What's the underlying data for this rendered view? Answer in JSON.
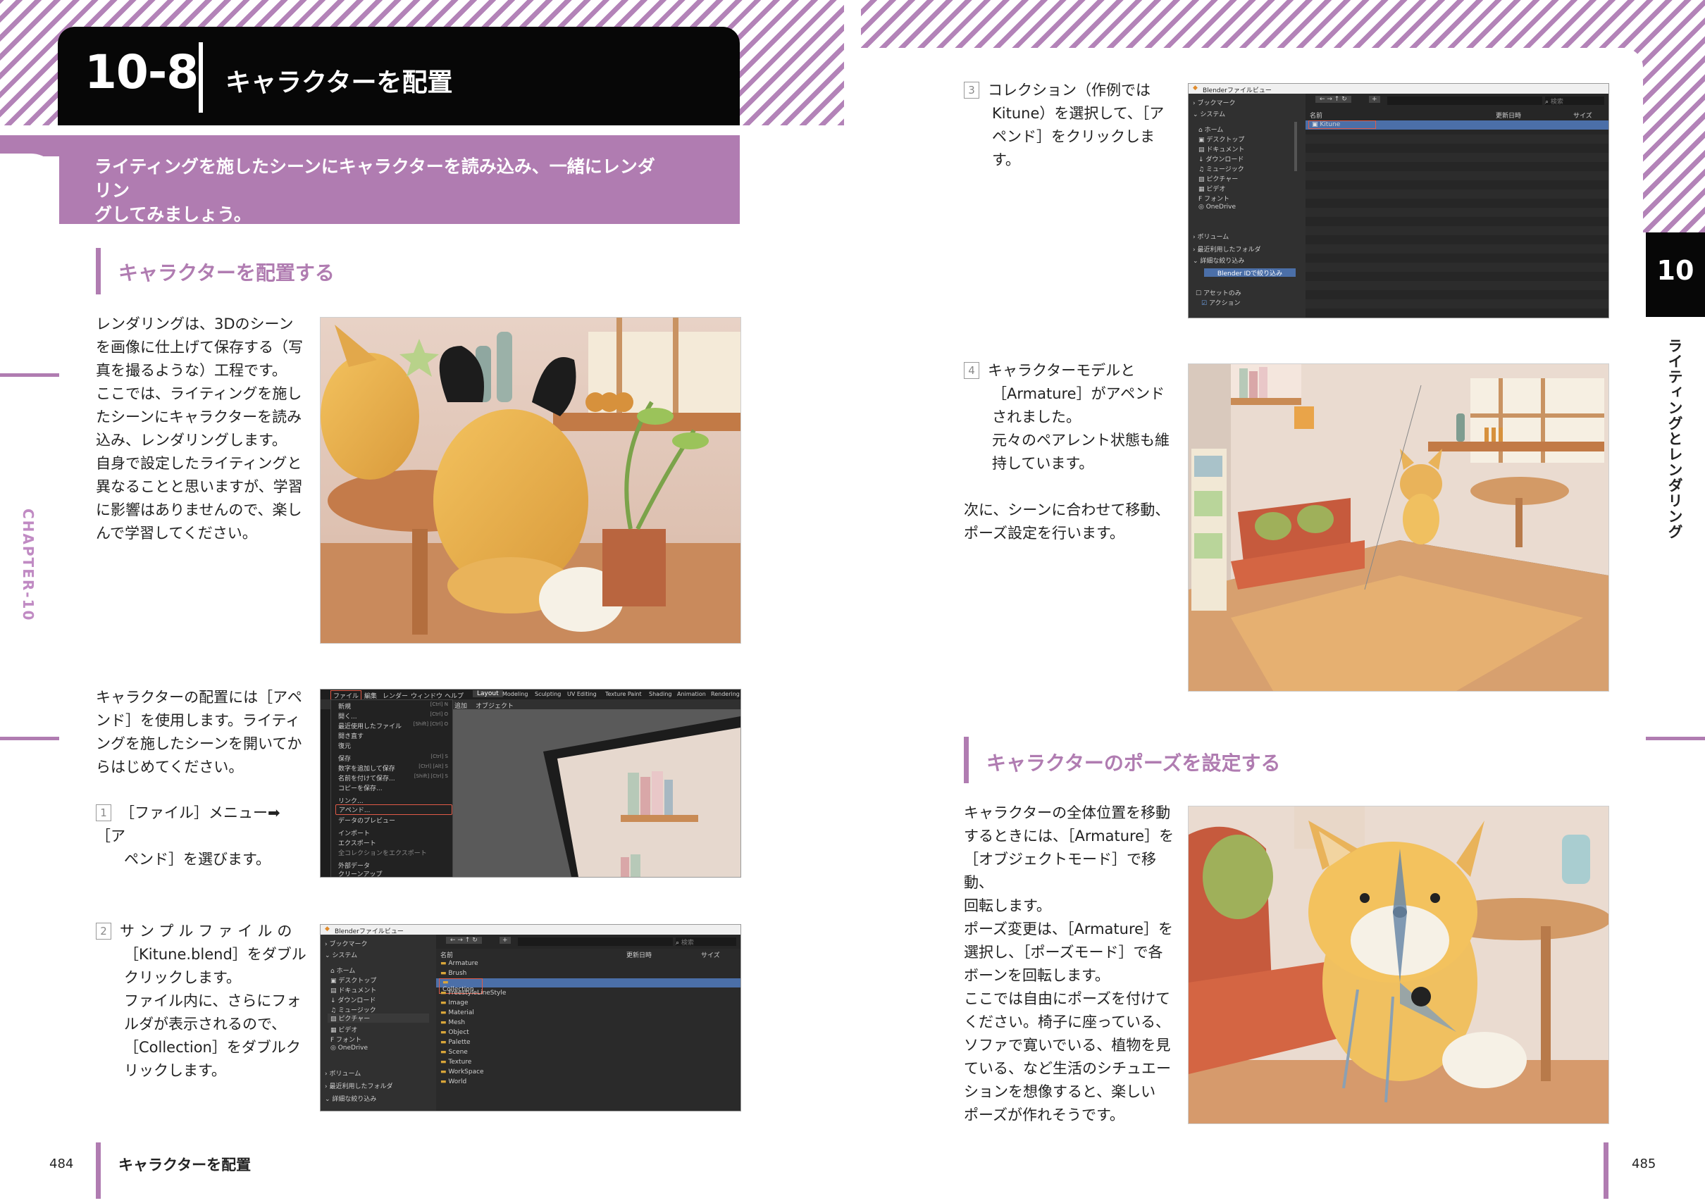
{
  "section": {
    "number": "10-8",
    "title": "キャラクターを配置"
  },
  "lead": [
    "ライティングを施したシーンにキャラクターを読み込み、一緒にレンダリン",
    "グしてみましょう。"
  ],
  "left": {
    "heading": "キャラクターを配置する",
    "intro": [
      "レンダリングは、3Dのシーン",
      "を画像に仕上げて保存する（写",
      "真を撮るような）工程です。",
      "ここでは、ライティングを施し",
      "たシーンにキャラクターを読み",
      "込み、レンダリングします。",
      "自身で設定したライティングと",
      "異なることと思いますが、学習",
      "に影響はありませんので、楽し",
      "んで学習してください。"
    ],
    "append_intro": [
      "キャラクターの配置には［アペ",
      "ンド］を使用します。ライティ",
      "ングを施したシーンを開いてか",
      "らはじめてください。"
    ],
    "step1": {
      "num": "1",
      "lines": [
        "［ファイル］メニュー➡［ア",
        "ペンド］を選びます。"
      ]
    },
    "step2": {
      "num": "2",
      "lines": [
        "サンプルファイルの",
        "［Kitune.blend］をダブル",
        "クリックします。",
        "ファイル内に、さらにフォ",
        "ルダが表示されるので、",
        "［Collection］をダブルク",
        "リックします。"
      ]
    }
  },
  "right": {
    "step3": {
      "num": "3",
      "lines": [
        "コレクション（作例では",
        "Kitune）を選択して、［ア",
        "ペンド］をクリックします。"
      ]
    },
    "step4": {
      "num": "4",
      "lines": [
        "キャラクターモデルと",
        "［Armature］がアペンド",
        "されました。",
        "元々のペアレント状態も維",
        "持しています。"
      ]
    },
    "step4_next": [
      "次に、シーンに合わせて移動、",
      "ポーズ設定を行います。"
    ],
    "heading": "キャラクターのポーズを設定する",
    "pose": [
      "キャラクターの全体位置を移動",
      "するときには、［Armature］を",
      "［オブジェクトモード］で移動、",
      "回転します。",
      "ポーズ変更は、［Armature］を",
      "選択し、［ポーズモード］で各",
      "ボーンを回転します。",
      "ここでは自由にポーズを付けて",
      "ください。椅子に座っている、",
      "ソファで寛いでいる、植物を見",
      "ている、など生活のシチュエー",
      "ションを想像すると、楽しい",
      "ポーズが作れそうです。"
    ]
  },
  "ui_menu": {
    "menubar": [
      "ファイル",
      "編集",
      "レンダー",
      "ウィンドウ",
      "ヘルプ"
    ],
    "workspaces": [
      "Layout",
      "Modeling",
      "Sculpting",
      "UV Editing",
      "Texture Paint",
      "Shading",
      "Animation",
      "Rendering"
    ],
    "header2": [
      "追加",
      "オブジェクト"
    ],
    "items": [
      "新規",
      "開く...",
      "最近使用したファイル",
      "開き直す",
      "復元",
      "保存",
      "数字を追加して保存",
      "名前を付けて保存...",
      "コピーを保存...",
      "リンク...",
      "アペンド...",
      "データのプレビュー",
      "インポート",
      "エクスポート",
      "全コレクションをエクスポート",
      "外部データ",
      "クリーンアップ"
    ],
    "shortcuts": [
      "[Ctrl] N",
      "[Ctrl] O",
      "[Shift] [Ctrl] O",
      "",
      "",
      "[Ctrl] S",
      "[Ctrl] [Alt] S",
      "[Shift] [Ctrl] S",
      "",
      "",
      "",
      "",
      "",
      "",
      "",
      "",
      ""
    ]
  },
  "ui_browser": {
    "title": "Blenderファイルビュー",
    "bookmarks": "ブックマーク",
    "system": "システム",
    "places": [
      "ホーム",
      "デスクトップ",
      "ドキュメント",
      "ダウンロード",
      "ミュージック",
      "ピクチャー",
      "ビデオ",
      "フォント",
      "OneDrive"
    ],
    "volumes": "ボリューム",
    "recent": "最近利用したフォルダ",
    "filter": "詳細な絞り込み",
    "filter_btn": "Blender IDで絞り込み",
    "asset_only": "アセットのみ",
    "action": "アクション",
    "search": "検索",
    "cols": [
      "名前",
      "更新日時",
      "サイズ"
    ],
    "folders": [
      "Armature",
      "Brush",
      "Collection",
      "FreestyleLineStyle",
      "Image",
      "Material",
      "Mesh",
      "Object",
      "Palette",
      "Scene",
      "Texture",
      "WorkSpace",
      "World"
    ],
    "selected": "Kitune"
  },
  "sidebar": {
    "chapter_num": "10",
    "chapter_title": "ライティングとレンダリング",
    "chapter_label": "CHAPTER-10"
  },
  "footer": {
    "left_page": "484",
    "right_page": "485",
    "title": "キャラクターを配置"
  },
  "colors": {
    "accent": "#b07cb1",
    "black": "#070707",
    "highlight": "#e05a47",
    "select": "#4b6fa8"
  }
}
